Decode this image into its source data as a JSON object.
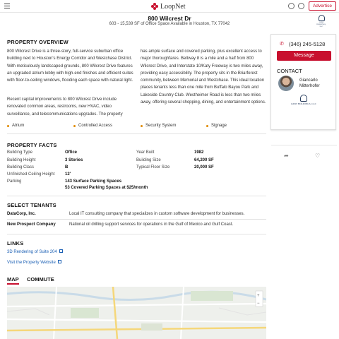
{
  "header": {
    "logo_text": "LoopNet",
    "advertise_label": "Advertise",
    "icons": [
      "hamburger-menu-icon",
      "globe-icon",
      "user-icon"
    ]
  },
  "listing": {
    "title": "800 Wilcrest Dr",
    "subtitle": "603 - 15,539 SF of Office Space Available in Houston, TX 77042"
  },
  "contact_card": {
    "phone": "(346) 245-5128",
    "message_label": "Message",
    "contact_label": "CONTACT",
    "agent_name": "Giancarlo Mitterhofer",
    "company_logo_text": "GMW HOLDINGS, LLC"
  },
  "overview": {
    "heading": "PROPERTY OVERVIEW",
    "col1_p1": "800 Wilcrest Drive is a three-story, full-service suburban office building next to Houston's Energy Corridor and Westchase District. With meticulously landscaped grounds, 800 Wilcrest Drive features an upgraded atrium lobby with high-end finishes and efficient suites with floor-to-ceiling windows, flooding each space with natural light.",
    "col1_p2": "Recent capital improvements to 800 Wilcrest Drive include renovated common areas, restrooms, new HVAC, video surveillance, and telecommunications upgrades. The property",
    "col2_p1": "has ample surface and covered parking, plus excellent access to major thoroughfares. Beltway 8 is a mile and a half from 800 Wilcrest Drive, and Interstate 10/Katy Freeway is two miles away, providing easy accessibility. The property sits in the Briarforest community, between Memorial and Westchase. This ideal location places tenants less than one mile from Buffalo Bayou Park and Lakeside Country Club. Westheimer Road is less than two miles away, offering several shopping, dining, and entertainment options.",
    "amenities": [
      "Atrium",
      "Controlled Access",
      "Security System",
      "Signage"
    ]
  },
  "facts": {
    "heading": "PROPERTY FACTS",
    "left": [
      {
        "label": "Building Type",
        "value": "Office"
      },
      {
        "label": "Building Height",
        "value": "3 Stories"
      },
      {
        "label": "Building Class",
        "value": "B"
      },
      {
        "label": "Unfinished Ceiling Height",
        "value": "12'"
      },
      {
        "label": "Parking",
        "value": "143 Surface Parking Spaces"
      }
    ],
    "parking_extra": "53 Covered Parking Spaces at $25/month",
    "right": [
      {
        "label": "Year Built",
        "value": "1982"
      },
      {
        "label": "Building Size",
        "value": "64,200 SF"
      },
      {
        "label": "Typical Floor Size",
        "value": "20,000 SF"
      }
    ]
  },
  "tenants": {
    "heading": "SELECT TENANTS",
    "rows": [
      {
        "name": "DataCorp, Inc.",
        "desc": "Local IT consulting company that specializes in custom software development for businesses."
      },
      {
        "name": "New Prospect Company",
        "desc": "National oil drilling support services for operations in the Gulf of Mexico and Gulf Coast."
      }
    ]
  },
  "links": {
    "heading": "LINKS",
    "items": [
      "3D Rendering of Suite 204",
      "Visit the Property Website"
    ]
  },
  "tabs": {
    "map": "MAP",
    "commute": "COMMUTE"
  },
  "colors": {
    "accent": "#c8102e",
    "link": "#1a5fb4",
    "amenity_bullet": "#e08a00"
  }
}
